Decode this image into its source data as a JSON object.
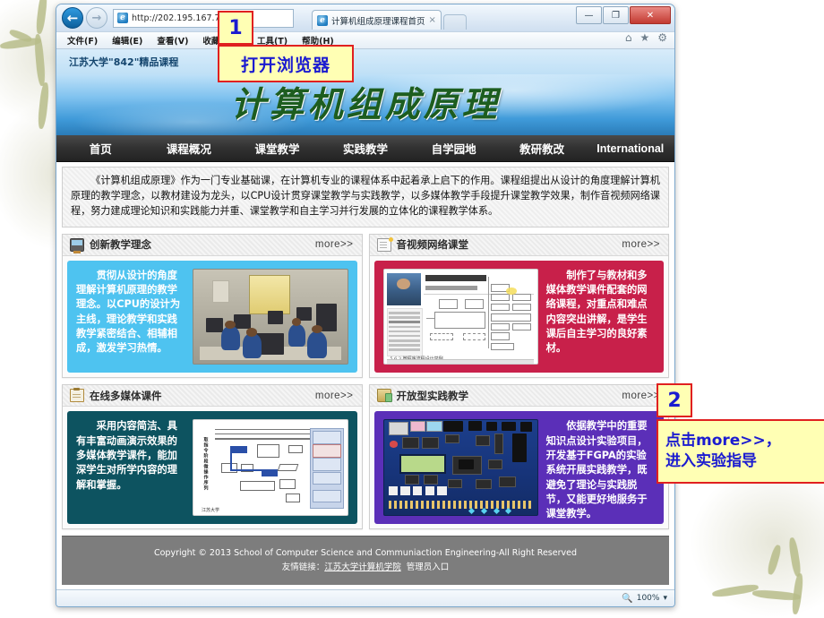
{
  "browser": {
    "url": "http://202.195.167.7/zcyl/",
    "tab_title": "计算机组成原理课程首页",
    "tab_close": "×",
    "back_icon": "←",
    "forward_icon": "→",
    "minimize": "—",
    "maximize": "❐",
    "close": "✕",
    "home_icon": "⌂",
    "favorites_icon": "★",
    "tools_icon": "⚙",
    "menu": [
      "文件(F)",
      "编辑(E)",
      "查看(V)",
      "收藏夹(A)",
      "工具(T)",
      "帮助(H)"
    ],
    "status": {
      "zoom": "100%",
      "zoom_icon": "🔍",
      "dropdown": "▾"
    }
  },
  "site": {
    "top_label": "江苏大学\"842\"精品课程",
    "banner_title": "计算机组成原理",
    "nav": [
      "首页",
      "课程概况",
      "课堂教学",
      "实践教学",
      "自学园地",
      "教研教改",
      "International"
    ],
    "intro": "《计算机组成原理》作为一门专业基础课，在计算机专业的课程体系中起着承上启下的作用。课程组提出从设计的角度理解计算机原理的教学理念，以教材建设为龙头，以CPU设计贯穿课堂教学与实践教学，以多媒体教学手段提升课堂教学效果，制作音视频网络课程，努力建成理论知识和实践能力并重、课堂教学和自主学习并行发展的立体化的课程教学体系。",
    "cards": [
      {
        "title": "创新教学理念",
        "icon": "monitor-icon",
        "more": "more>>",
        "text": "贯彻从设计的角度理解计算机原理的教学理念。以CPU的设计为主线，理论教学和实践教学紧密结合、相辅相成，激发学习热情。",
        "bg_color": "#4ec3f0",
        "thumb": "computer-lab-photo",
        "text_side": "left"
      },
      {
        "title": "音视频网络课堂",
        "icon": "book-icon",
        "more": "more>>",
        "text": "制作了与教材和多媒体教学课件配套的网络课程，对重点和难点内容突出讲解，是学生课后自主学习的良好素材。",
        "bg_color": "#c8204a",
        "thumb": "video-lecture-screenshot",
        "thumb_caption": "5.6.3 微程序流程设计举例",
        "text_side": "right"
      },
      {
        "title": "在线多媒体课件",
        "icon": "clipboard-icon",
        "more": "more>>",
        "text": "采用内容简洁、具有丰富动画演示效果的多媒体教学课件，能加深学生对所学内容的理解和掌握。",
        "bg_color": "#0d5360",
        "thumb": "courseware-diagram",
        "thumb_caption": "取指令阶段微操作序列",
        "text_side": "left"
      },
      {
        "title": "开放型实践教学",
        "icon": "folder-icon",
        "more": "more>>",
        "text": "依据教学中的重要知识点设计实验项目，开发基于FGPA的实验系统开展实践教学，既避免了理论与实践脱节，又能更好地服务于课堂教学。",
        "bg_color": "#5b2fb8",
        "thumb": "fpga-board-photo",
        "text_side": "right"
      }
    ],
    "footer": {
      "copyright": "Copyright © 2013 School of Computer Science and Communiaction Engineering-All Right Reserved",
      "links_label": "友情链接：",
      "link1": "江苏大学计算机学院",
      "link2": "管理员入口"
    }
  },
  "callouts": [
    {
      "number": "1",
      "text": "打开浏览器"
    },
    {
      "number": "2",
      "line1": "点击more>>，",
      "line2": "进入实验指导"
    }
  ],
  "colors": {
    "callout_bg": "#ffffb4",
    "callout_border": "#e02020",
    "callout_text": "#1b1bd0",
    "nav_bg": "#2b2b2b",
    "banner_title": "#1d5d1f",
    "footer_bg": "#7d7d7d"
  }
}
